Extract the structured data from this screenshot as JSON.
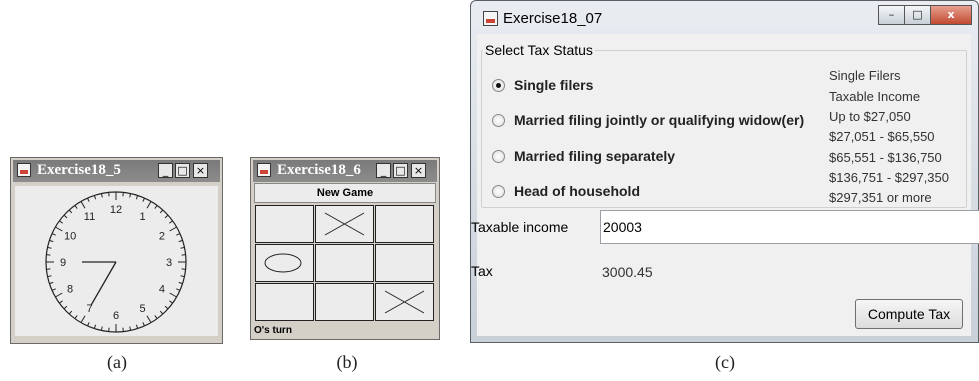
{
  "clock_window": {
    "title": "Exercise18_5",
    "minimize": "_",
    "maximize": "□",
    "close": "×",
    "clock": {
      "numbers": [
        "12",
        "1",
        "2",
        "3",
        "4",
        "5",
        "6",
        "7",
        "8",
        "9",
        "10",
        "11"
      ],
      "hour": 9,
      "minute": 35
    },
    "caption": "(a)"
  },
  "tictactoe_window": {
    "title": "Exercise18_6",
    "minimize": "_",
    "maximize": "□",
    "close": "×",
    "new_game_label": "New Game",
    "board": [
      "",
      "X",
      "",
      "O",
      "",
      "",
      "",
      "",
      "X"
    ],
    "status": "O's turn",
    "caption": "(b)"
  },
  "tax_window": {
    "title": "Exercise18_07",
    "minimize": "–",
    "maximize": "□",
    "close": "x",
    "group_label": "Select Tax Status",
    "options": [
      {
        "label": "Single filers",
        "selected": true
      },
      {
        "label": "Married filing jointly or qualifying widow(er)",
        "selected": false
      },
      {
        "label": "Married filing separately",
        "selected": false
      },
      {
        "label": "Head of household",
        "selected": false
      }
    ],
    "info_lines": [
      "Single Filers",
      "Taxable Income",
      "Up to $27,050",
      "$27,051 - $65,550",
      "$65,551 - $136,750",
      "$136,751 - $297,350",
      "$297,351 or more"
    ],
    "taxable_income_label": "Taxable income",
    "taxable_income_value": "20003",
    "tax_label": "Tax",
    "tax_value": "3000.45",
    "compute_label": "Compute Tax",
    "caption": "(c)"
  }
}
